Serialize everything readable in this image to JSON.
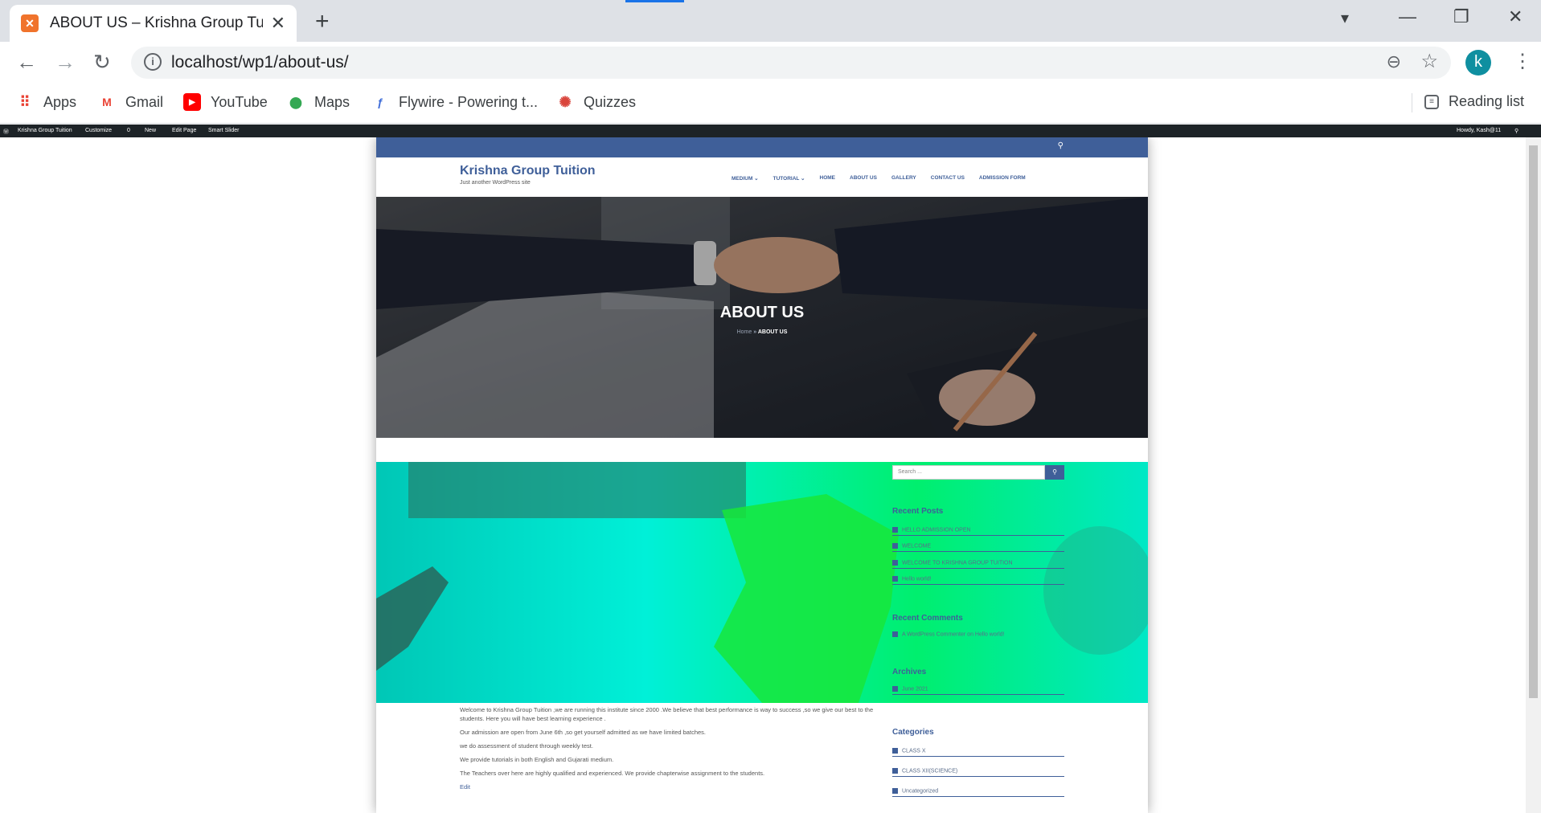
{
  "browser": {
    "tab_title": "ABOUT US – Krishna Group Tuitio",
    "url": "localhost/wp1/about-us/",
    "profile_initial": "k",
    "bookmarks": [
      "Apps",
      "Gmail",
      "YouTube",
      "Maps",
      "Flywire - Powering t...",
      "Quizzes"
    ],
    "reading_list": "Reading list"
  },
  "adminbar": {
    "site": "Krishna Group Tuition",
    "customize": "Customize",
    "comments": "0",
    "new": "New",
    "edit_page": "Edit Page",
    "smart_slider": "Smart Slider",
    "howdy": "Howdy, Kash@11"
  },
  "site": {
    "name": "Krishna Group Tuition",
    "tagline": "Just another WordPress site",
    "menu": [
      "MEDIUM ⌄",
      "TUTORIAL ⌄",
      "HOME",
      "ABOUT US",
      "GALLERY",
      "CONTACT US",
      "ADMISSION FORM"
    ],
    "hero_title": "ABOUT US",
    "breadcrumb_home": "Home",
    "breadcrumb_current": "ABOUT US"
  },
  "sidebar": {
    "search_placeholder": "Search ...",
    "recent_posts_title": "Recent Posts",
    "recent_posts": [
      "HELLO ADMISSION OPEN",
      "WELCOME",
      "WELCOME TO KRISHNA GROUP TUITION",
      "Hello world!"
    ],
    "recent_comments_title": "Recent Comments",
    "recent_comment": "A WordPress Commenter on Hello world!",
    "archives_title": "Archives",
    "archive": "June 2021",
    "categories_title": "Categories",
    "categories": [
      "CLASS X",
      "CLASS XII(SCIENCE)",
      "Uncategorized"
    ]
  },
  "content": {
    "paragraphs": [
      "Welcome to Krishna Group Tuition ,we are running this institute since 2000 .We believe that best performance is way to success ,so we give our best to the students. Here you will have best learning experience .",
      "Our admission are open from June 6th ,so get yourself admitted as we have limited batches.",
      "we do assessment of student through weekly test.",
      "We provide tutorials in both English and Gujarati medium.",
      "The Teachers over here are highly qualified and experienced. We provide chapterwise assignment to the students."
    ],
    "edit_link": "Edit"
  },
  "colors": {
    "brand": "#3f5f99",
    "feature_bg": "#00e8d5"
  }
}
